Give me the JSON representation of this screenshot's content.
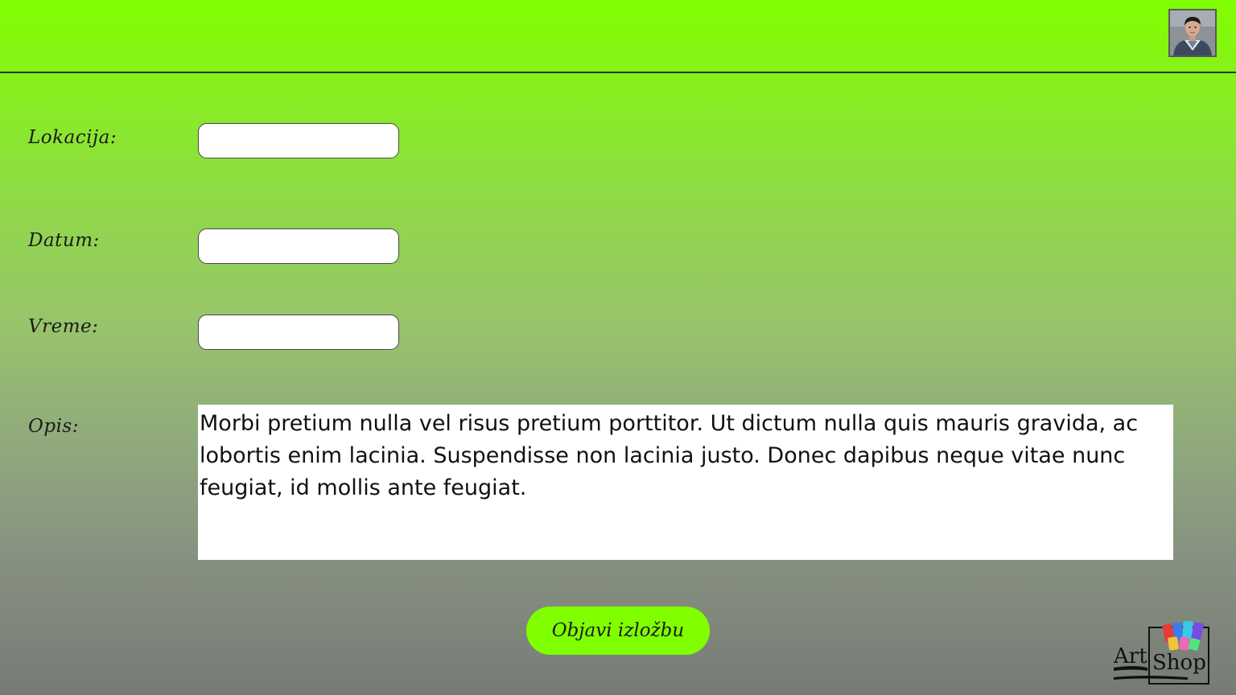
{
  "header": {
    "avatar_icon": "user-avatar-icon"
  },
  "form": {
    "location_label": "Lokacija:",
    "location_value": "",
    "date_label": "Datum:",
    "date_value": "",
    "time_label": "Vreme:",
    "time_value": "",
    "description_label": "Opis:",
    "description_value": "Morbi pretium nulla vel risus pretium porttitor. Ut dictum nulla quis mauris gravida, ac lobortis enim lacinia. Suspendisse non lacinia justo. Donec dapibus neque vitae nunc feugiat, id mollis ante feugiat.",
    "submit_label": "Objavi izložbu"
  },
  "logo": {
    "line1": "Art",
    "line2": "Shop"
  },
  "colors": {
    "accent": "#80ff00",
    "header_border": "#2a3a22"
  }
}
